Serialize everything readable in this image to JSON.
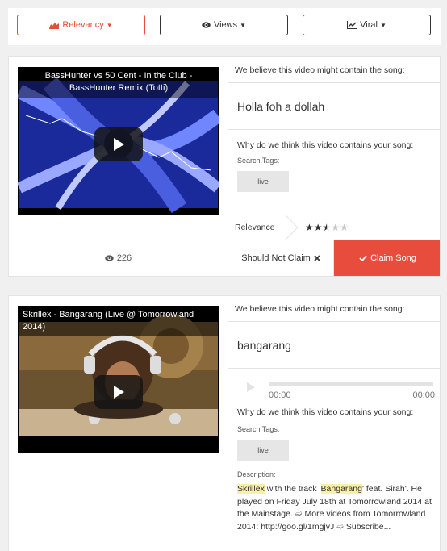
{
  "filters": [
    {
      "label": "Relevancy",
      "icon": "area-chart-icon",
      "active": true
    },
    {
      "label": "Views",
      "icon": "eye-icon",
      "active": false
    },
    {
      "label": "Viral",
      "icon": "line-chart-icon",
      "active": false
    }
  ],
  "cards": [
    {
      "video_title": "BassHunter vs 50 Cent - In the Club - BassHunter Remix (Totti)",
      "believe_text": "We believe this video might contain the song:",
      "song_title": "Holla foh a dollah",
      "why_text": "Why do we think this video contains your song:",
      "search_tags_label": "Search Tags:",
      "tags": [
        "live"
      ],
      "relevance_label": "Relevance",
      "relevance_rating": 2.5,
      "relevance_max": 5,
      "views": "226",
      "not_claim_label": "Should Not Claim",
      "claim_label": "Claim Song"
    },
    {
      "video_title": "Skrillex - Bangarang (Live @ Tomorrowland 2014)",
      "believe_text": "We believe this video might contain the song:",
      "song_title": "bangarang",
      "audio_time_start": "00:00",
      "audio_time_end": "00:00",
      "why_text": "Why do we think this video contains your song:",
      "search_tags_label": "Search Tags:",
      "tags": [
        "live"
      ],
      "description_label": "Description:",
      "description": {
        "hl1": "Skrillex",
        "t1": " with the track '",
        "hl2": "Bangarang",
        "t2": "' feat. Sirah'. He played on Friday July 18th at Tomorrowland 2014 at the Mainstage. ",
        "arrow": "➫",
        "t3": " More videos from Tomorrowland 2014: http://goo.gl/1mgjvJ ",
        "t4": " Subscribe..."
      }
    }
  ],
  "colors": {
    "accent": "#e74c3c",
    "highlight": "#f7f0a6"
  }
}
